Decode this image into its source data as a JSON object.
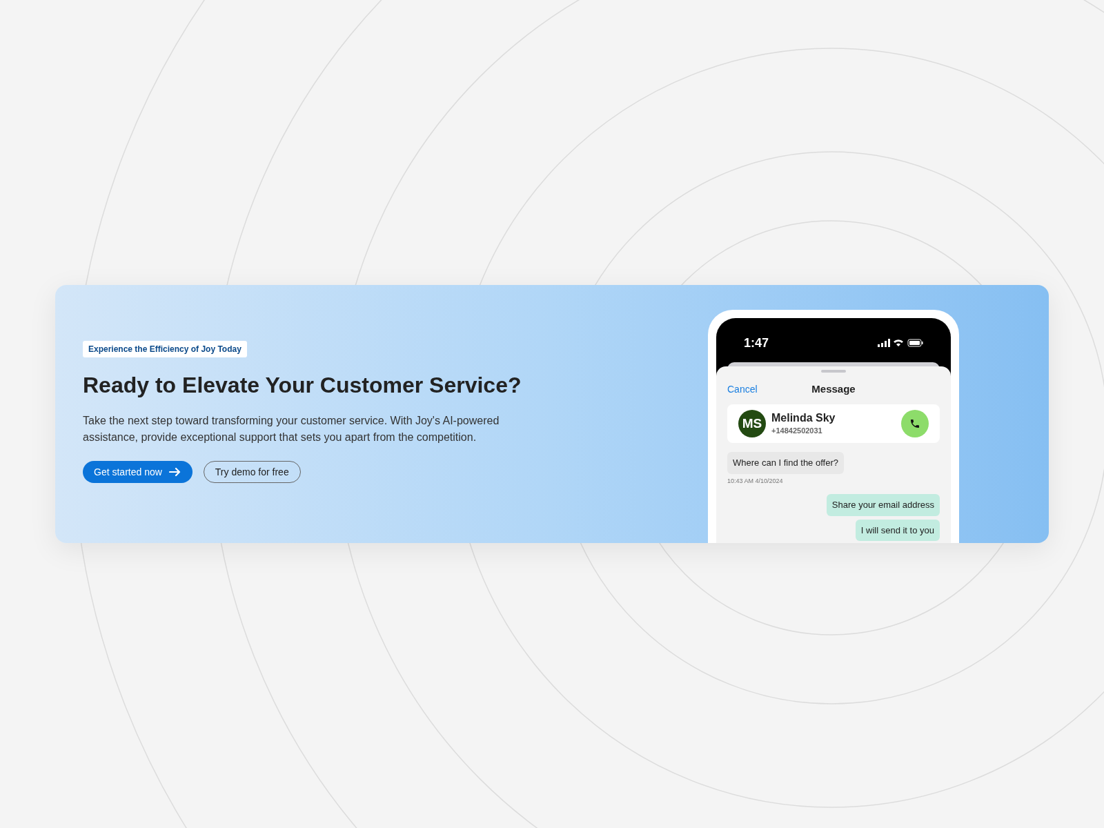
{
  "banner": {
    "tag": "Experience the Efficiency of Joy Today",
    "heading": "Ready to Elevate Your Customer Service?",
    "body": "Take the next step toward transforming your customer service. With Joy's AI-powered assistance, provide exceptional support that sets you apart from the competition.",
    "buttons": [
      {
        "label": "Get started now",
        "kind": "primary"
      },
      {
        "label": "Try demo for free",
        "kind": "outline"
      }
    ]
  },
  "phone": {
    "time": "1:47",
    "sheet": {
      "cancel": "Cancel",
      "title": "Message"
    },
    "contact": {
      "initials": "MS",
      "name": "Melinda Sky",
      "phone": "+14842502031"
    },
    "messages": [
      {
        "kind": "incoming",
        "text": "Where can I find the offer?",
        "timestamp": "10:43 AM 4/10/2024"
      },
      {
        "kind": "outgoing",
        "text": "Share your email address"
      },
      {
        "kind": "outgoing",
        "text": "I will send it to you"
      }
    ]
  }
}
